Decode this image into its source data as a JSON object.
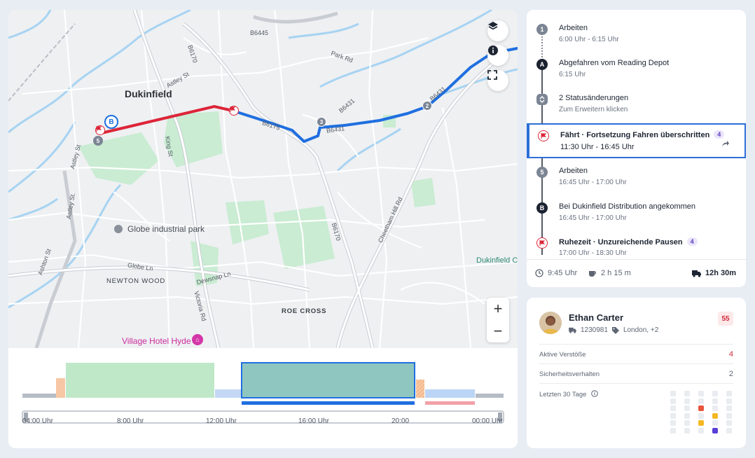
{
  "map": {
    "labels": {
      "town": "Dukinfield",
      "b6445": "B6445",
      "park_rd": "Park Rd",
      "b6170_top": "B6170",
      "astley_st_top": "Astley St",
      "b6431_1": "B6431",
      "b6431_2": "B6431",
      "king_st": "King St",
      "astley_st_left": "Astley St",
      "astley_st_mid": "Astley St.",
      "ashton_st": "Ashton St",
      "globe_park": "Globe industrial park",
      "globe_ln": "Globe Ln",
      "newton_wood": "NEWTON WOOD",
      "dewsnap_ln": "Dewsnap Ln",
      "victoria_rd": "Victoria Rd",
      "roe_cross": "ROE CROSS",
      "b6170_mid": "B6170",
      "cheetham_hill": "Cheetham Hill Rd",
      "dukinfield_right": "Dukinfield C",
      "village_hotel": "Village Hotel Hyde",
      "route_label_1": "B6175",
      "route_label_2": "B6431"
    },
    "markers": {
      "b": "B",
      "five": "5",
      "three": "3",
      "two": "2"
    },
    "controls": {
      "zoom_in": "+",
      "zoom_out": "−"
    }
  },
  "timeline": {
    "ticks": [
      "04:00 Uhr",
      "8:00 Uhr",
      "12:00 Uhr",
      "16:00 Uhr",
      "20:00",
      "00:00 Uhr"
    ]
  },
  "events": [
    {
      "marker": "1",
      "title": "Arbeiten",
      "time": "6:00 Uhr - 6:15 Uhr"
    },
    {
      "marker": "A",
      "title": "Abgefahren vom Reading Depot",
      "time": "6:15 Uhr"
    },
    {
      "marker": "",
      "title": "2 Statusänderungen",
      "time": "Zum Erweitern klicken"
    },
    {
      "marker": "",
      "title": "Fährt · Fortsetzung Fahren überschritten",
      "badge": "4",
      "time": "11:30 Uhr - 16:45 Uhr"
    },
    {
      "marker": "5",
      "title": "Arbeiten",
      "time": "16:45 Uhr - 17:00 Uhr"
    },
    {
      "marker": "B",
      "title": "Bei Dukinfield Distribution angekommen",
      "time": "16:45 Uhr - 17:00 Uhr"
    },
    {
      "marker": "",
      "title": "Ruhezeit · Unzureichende Pausen",
      "badge": "4",
      "time": "17:00 Uhr - 18:30 Uhr"
    }
  ],
  "summary": {
    "start": "9:45 Uhr",
    "break": "2 h 15 m",
    "total": "12h 30m"
  },
  "driver": {
    "name": "Ethan Carter",
    "vehicle": "1230981",
    "location": "London, +2",
    "score": "55",
    "stats": [
      {
        "label": "Aktive Verstöße",
        "value": "4",
        "color": "#d1283a"
      },
      {
        "label": "Sicherheitsverhalten",
        "value": "2",
        "color": "#1d2533"
      },
      {
        "label": "Letzten 30 Tage",
        "value": ""
      }
    ]
  },
  "colors": {
    "route_blue": "#1f6fe0",
    "route_red": "#dd2538",
    "park_green": "#c8ecd0",
    "water": "#9fd0f2",
    "selected_border": "#2d6fd6"
  }
}
